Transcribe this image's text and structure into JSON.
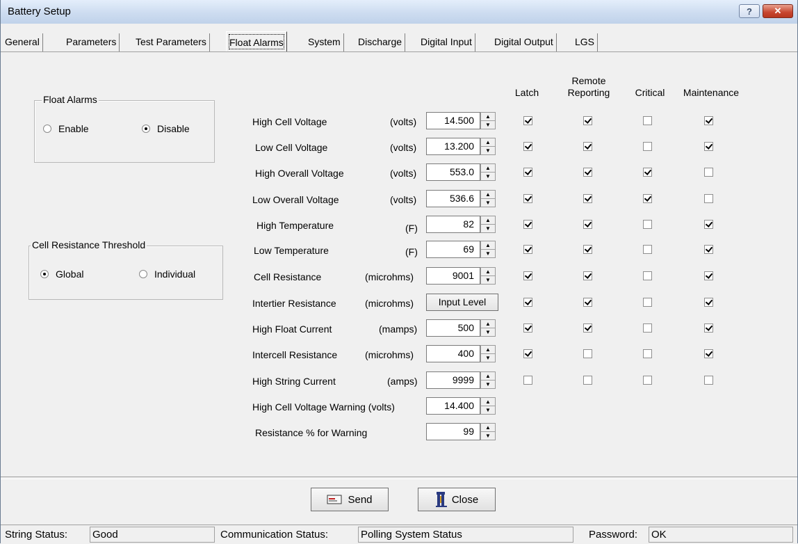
{
  "window": {
    "title": "Battery Setup",
    "help_label": "?",
    "close_label": "✕"
  },
  "tabs": [
    {
      "label": "General",
      "active": false
    },
    {
      "label": "Parameters",
      "active": false
    },
    {
      "label": "Test Parameters",
      "active": false
    },
    {
      "label": "Float Alarms",
      "active": true
    },
    {
      "label": "System",
      "active": false
    },
    {
      "label": "Discharge",
      "active": false
    },
    {
      "label": "Digital Input",
      "active": false
    },
    {
      "label": "Digital Output",
      "active": false
    },
    {
      "label": "LGS",
      "active": false
    }
  ],
  "float_alarms_group": {
    "legend": "Float Alarms",
    "options": [
      {
        "label": "Enable",
        "selected": false
      },
      {
        "label": "Disable",
        "selected": true
      }
    ]
  },
  "cell_resistance_group": {
    "legend": "Cell Resistance Threshold",
    "options": [
      {
        "label": "Global",
        "selected": true
      },
      {
        "label": "Individual",
        "selected": false
      }
    ]
  },
  "columns": {
    "latch": "Latch",
    "remote_1": "Remote",
    "remote_2": "Reporting",
    "critical": "Critical",
    "maintenance": "Maintenance"
  },
  "alarms": [
    {
      "label": "High Cell Voltage",
      "unit": "(volts)",
      "value": "14.500",
      "latch": true,
      "remote": true,
      "critical": false,
      "maintenance": true
    },
    {
      "label": "Low Cell Voltage",
      "unit": "(volts)",
      "value": "13.200",
      "latch": true,
      "remote": true,
      "critical": false,
      "maintenance": true
    },
    {
      "label": "High Overall Voltage",
      "unit": "(volts)",
      "value": "553.0",
      "latch": true,
      "remote": true,
      "critical": true,
      "maintenance": false
    },
    {
      "label": "Low Overall Voltage",
      "unit": "(volts)",
      "value": "536.6",
      "latch": true,
      "remote": true,
      "critical": true,
      "maintenance": false
    },
    {
      "label": "High Temperature",
      "unit": "(F)",
      "value": "82",
      "latch": true,
      "remote": true,
      "critical": false,
      "maintenance": true
    },
    {
      "label": "Low Temperature",
      "unit": "(F)",
      "value": "69",
      "latch": true,
      "remote": true,
      "critical": false,
      "maintenance": true
    },
    {
      "label": "Cell Resistance",
      "unit": "(microhms)",
      "value": "9001",
      "latch": true,
      "remote": true,
      "critical": false,
      "maintenance": true
    },
    {
      "label": "Intertier Resistance",
      "unit": "(microhms)",
      "value": "Input Level",
      "latch": true,
      "remote": true,
      "critical": false,
      "maintenance": true
    },
    {
      "label": "High Float Current",
      "unit": "(mamps)",
      "value": "500",
      "latch": true,
      "remote": true,
      "critical": false,
      "maintenance": true
    },
    {
      "label": "Intercell Resistance",
      "unit": "(microhms)",
      "value": "400",
      "latch": true,
      "remote": false,
      "critical": false,
      "maintenance": true
    },
    {
      "label": "High String  Current",
      "unit": "(amps)",
      "value": "9999",
      "latch": false,
      "remote": false,
      "critical": false,
      "maintenance": false
    },
    {
      "label": "High Cell Voltage Warning (volts)",
      "unit": "",
      "value": "14.400"
    },
    {
      "label": "Resistance % for Warning",
      "unit": "",
      "value": "99"
    }
  ],
  "buttons": {
    "send": "Send",
    "close": "Close"
  },
  "status": {
    "string_label": "String Status:",
    "string_value": "Good",
    "comm_label": "Communication Status:",
    "comm_value": "Polling System Status",
    "password_label": "Password:",
    "password_value": "OK"
  }
}
